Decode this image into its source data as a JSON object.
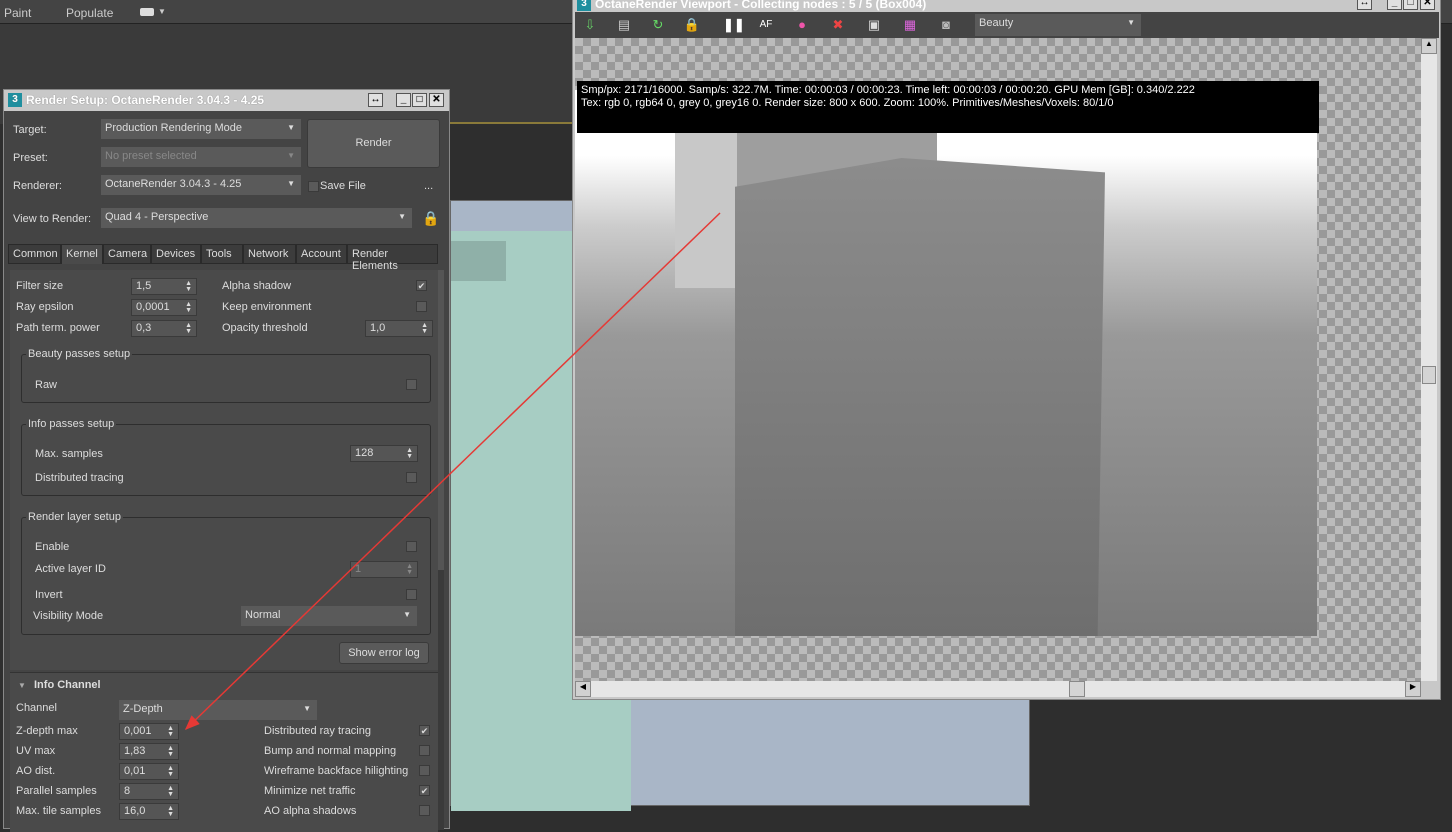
{
  "topbar": {
    "items": [
      "Paint",
      "Populate"
    ]
  },
  "render_setup": {
    "title": "Render Setup: OctaneRender 3.04.3 - 4.25",
    "target_label": "Target:",
    "target_value": "Production Rendering Mode",
    "preset_label": "Preset:",
    "preset_value": "No preset selected",
    "renderer_label": "Renderer:",
    "renderer_value": "OctaneRender 3.04.3 - 4.25",
    "save_file": "Save File",
    "more": "...",
    "render_button": "Render",
    "view_label": "View to Render:",
    "view_value": "Quad 4 - Perspective",
    "tabs": [
      "Common",
      "Kernel",
      "Camera",
      "Devices",
      "Tools",
      "Network",
      "Account",
      "Render Elements"
    ],
    "active_tab": "Kernel",
    "kernel": {
      "filter_size": {
        "label": "Filter size",
        "value": "1,5"
      },
      "ray_epsilon": {
        "label": "Ray epsilon",
        "value": "0,0001"
      },
      "path_term": {
        "label": "Path term. power",
        "value": "0,3"
      },
      "alpha_shadow": {
        "label": "Alpha shadow",
        "checked": true
      },
      "keep_env": {
        "label": "Keep environment",
        "checked": false
      },
      "opacity": {
        "label": "Opacity threshold",
        "value": "1,0"
      },
      "beauty_group": "Beauty passes setup",
      "raw": "Raw",
      "info_group": "Info passes setup",
      "max_samples": {
        "label": "Max. samples",
        "value": "128"
      },
      "distributed_tracing": "Distributed tracing",
      "layer_group": "Render layer setup",
      "enable": "Enable",
      "active_layer": {
        "label": "Active layer ID",
        "value": "1"
      },
      "invert": "Invert",
      "visibility": {
        "label": "Visibility Mode",
        "value": "Normal"
      },
      "show_error_log": "Show error log"
    },
    "info_channel": {
      "title": "Info Channel",
      "channel_label": "Channel",
      "channel_value": "Z-Depth",
      "zdepth": {
        "label": "Z-depth max",
        "value": "0,001"
      },
      "uvmax": {
        "label": "UV max",
        "value": "1,83"
      },
      "aodist": {
        "label": "AO dist.",
        "value": "0,01"
      },
      "parallel": {
        "label": "Parallel samples",
        "value": "8"
      },
      "maxtile": {
        "label": "Max. tile samples",
        "value": "16,0"
      },
      "checks": [
        {
          "label": "Distributed ray tracing",
          "checked": true
        },
        {
          "label": "Bump and normal mapping",
          "checked": false
        },
        {
          "label": "Wireframe backface hilighting",
          "checked": false
        },
        {
          "label": "Minimize net traffic",
          "checked": true
        },
        {
          "label": "AO alpha shadows",
          "checked": false
        }
      ]
    }
  },
  "viewport": {
    "title": "OctaneRender Viewport - Collecting nodes : 5 / 5 (Box004)",
    "pass_value": "Beauty",
    "info_line1": "Smp/px: 2171/16000.   Samp/s: 322.7M.   Time: 00:00:03 / 00:00:23.   Time left: 00:00:03 / 00:00:20.   GPU Mem [GB]: 0.340/2.222",
    "info_line2": "Tex: rgb 0, rgb64 0, grey 0, grey16 0.   Render size: 800 x 600.   Zoom: 100%.   Primitives/Meshes/Voxels: 80/1/0"
  },
  "colors": {
    "annotation_arrow": "#e53935",
    "panel": "#444444"
  }
}
